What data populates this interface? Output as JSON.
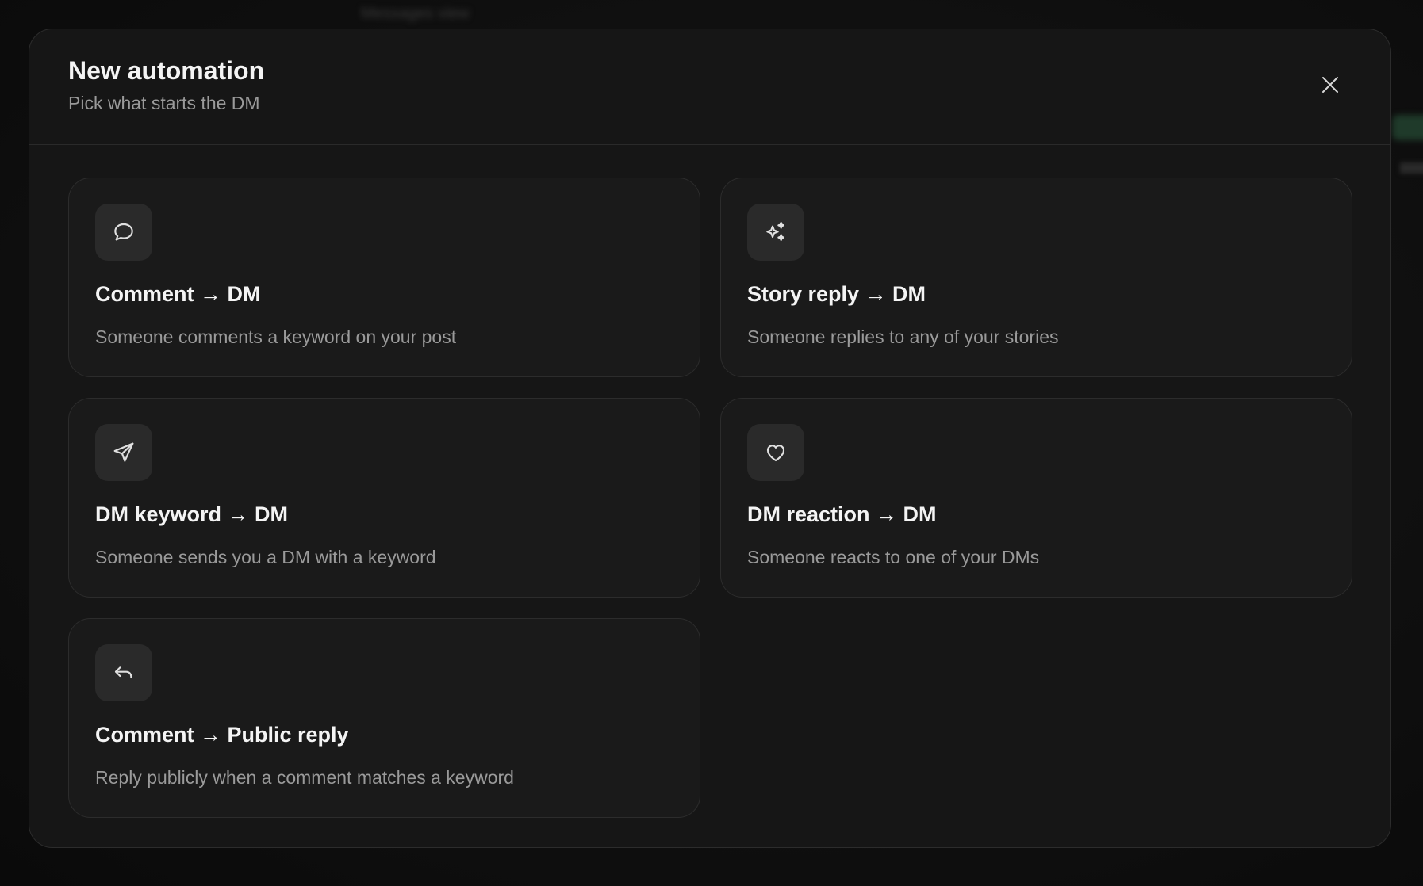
{
  "background": {
    "blurred_text": "Messages view"
  },
  "modal": {
    "title": "New automation",
    "subtitle": "Pick what starts the DM",
    "close_icon": "close-icon"
  },
  "triggers": [
    {
      "icon": "message-bubble-icon",
      "title": "Comment → DM",
      "description": "Someone comments a keyword on your post"
    },
    {
      "icon": "sparkles-icon",
      "title": "Story reply → DM",
      "description": "Someone replies to any of your stories"
    },
    {
      "icon": "send-icon",
      "title": "DM keyword → DM",
      "description": "Someone sends you a DM with a keyword"
    },
    {
      "icon": "heart-icon",
      "title": "DM reaction → DM",
      "description": "Someone reacts to one of your DMs"
    },
    {
      "icon": "reply-arrow-icon",
      "title": "Comment → Public reply",
      "description": "Reply publicly when a comment matches a keyword"
    }
  ],
  "colors": {
    "modal_bg": "#161616",
    "card_bg": "#1a1a1a",
    "border": "#2c2c2c",
    "title_text": "#f4f4f4",
    "muted_text": "#9a9a9a"
  }
}
